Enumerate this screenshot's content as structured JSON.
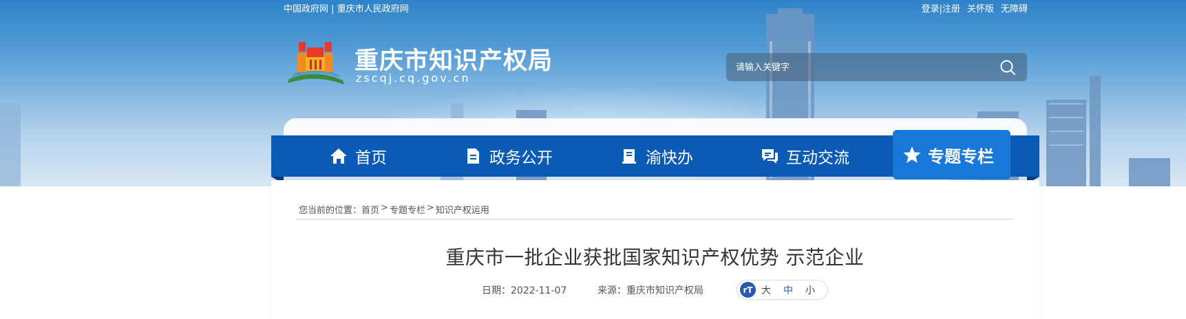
{
  "topbar": {
    "left_links": [
      "中国政府网",
      "重庆市人民政府网"
    ],
    "left_separator": "|",
    "right_links": [
      "登录|注册",
      "关怀版",
      "无障碍"
    ]
  },
  "header": {
    "site_title": "重庆市知识产权局",
    "site_domain": "zscqj.cq.gov.cn",
    "search_placeholder": "请输入关键字"
  },
  "nav": {
    "items": [
      {
        "label": "首页",
        "icon": "home-icon"
      },
      {
        "label": "政务公开",
        "icon": "document-icon"
      },
      {
        "label": "渝快办",
        "icon": "book-icon"
      },
      {
        "label": "互动交流",
        "icon": "chat-icon"
      },
      {
        "label": "专题专栏",
        "icon": "star-icon",
        "active": true
      }
    ]
  },
  "breadcrumb": {
    "prefix": "您当前的位置：",
    "items": [
      "首页",
      "专题专栏",
      "知识产权运用"
    ],
    "separator": ">"
  },
  "article": {
    "title": "重庆市一批企业获批国家知识产权优势 示范企业",
    "date_label": "日期：2022-11-07",
    "source_label": "来源：重庆市知识产权局",
    "font_sizes": [
      "大",
      "中",
      "小"
    ],
    "font_selected": "中",
    "font_icon_text": "rT"
  },
  "colors": {
    "nav_bg": "#0a5bb5",
    "nav_active": "#1878d8",
    "accent": "#2a5ab0"
  }
}
